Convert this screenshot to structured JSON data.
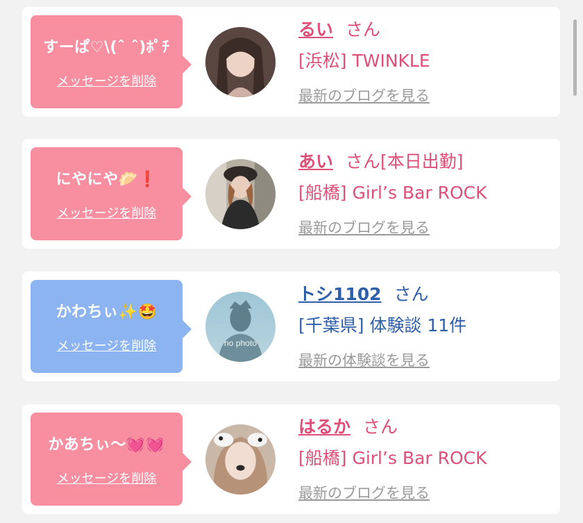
{
  "items": [
    {
      "message": "すーぱ♡\\(ˆ ˆ)ﾎﾟﾁ",
      "delete_label": "メッセージを削除",
      "name": "るい",
      "suffix": "さん",
      "status": "",
      "location": "[浜松] TWINKLE",
      "link": "最新のブログを見る",
      "color": "#f78fa0"
    },
    {
      "message": "にやにや🥟❗",
      "delete_label": "メッセージを削除",
      "name": "あい",
      "suffix": "さん",
      "status": "[本日出勤]",
      "location": "[船橋] Girl’s Bar ROCK",
      "link": "最新のブログを見る",
      "color": "#f78fa0"
    },
    {
      "message": "かわちぃ✨🤩",
      "delete_label": "メッセージを削除",
      "name": "トシ1102",
      "suffix": "さん",
      "status": "",
      "location": "[千葉県] 体験談 11件",
      "link": "最新の体験談を見る",
      "avatar_text": "no photo",
      "color": "#8cb4f0"
    },
    {
      "message": "かあちぃ〜💓💓",
      "delete_label": "メッセージを削除",
      "name": "はるか",
      "suffix": "さん",
      "status": "",
      "location": "[船橋] Girl’s Bar ROCK",
      "link": "最新のブログを見る",
      "color": "#f78fa0"
    }
  ]
}
